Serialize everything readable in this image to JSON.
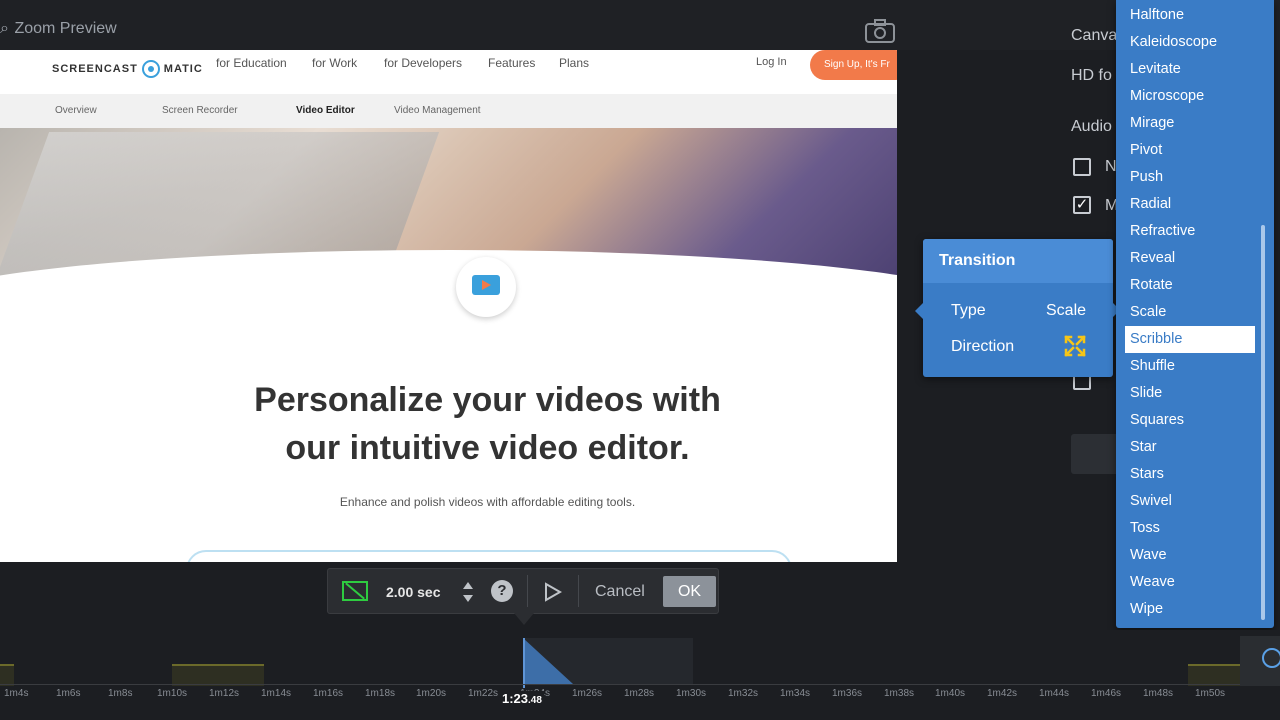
{
  "window": {
    "title": "Zoom Preview"
  },
  "site": {
    "logo_text_left": "SCREENCAST",
    "logo_text_right": "MATIC",
    "nav": [
      "for Education",
      "for Work",
      "for Developers",
      "Features",
      "Plans"
    ],
    "login": "Log In",
    "signup": "Sign Up, It's Fr",
    "subnav": [
      "Overview",
      "Screen Recorder",
      "Video Editor",
      "Video Management"
    ],
    "subnav_active": "Video Editor",
    "headline_1": "Personalize your videos with",
    "headline_2": "our intuitive video editor.",
    "subline": "Enhance and polish videos with affordable editing tools."
  },
  "right_panel": {
    "canvas_label": "Canva",
    "canvas_value": "HD fo",
    "audio_label": "Audio",
    "option_1": "N",
    "option_2": "M",
    "option_2_checked": true
  },
  "transition": {
    "title": "Transition",
    "type_label": "Type",
    "type_value": "Scale",
    "direction_label": "Direction",
    "direction_icon": "expand-arrows-icon"
  },
  "dropdown": {
    "items": [
      "Halftone",
      "Kaleidoscope",
      "Levitate",
      "Microscope",
      "Mirage",
      "Pivot",
      "Push",
      "Radial",
      "Refractive",
      "Reveal",
      "Rotate",
      "Scale",
      "Scribble",
      "Shuffle",
      "Slide",
      "Squares",
      "Star",
      "Stars",
      "Swivel",
      "Toss",
      "Wave",
      "Weave",
      "Wipe"
    ],
    "highlighted": "Scribble"
  },
  "toolbar": {
    "duration": "2.00 sec",
    "help": "?",
    "cancel": "Cancel",
    "ok": "OK"
  },
  "timeline": {
    "current_time": "1:23",
    "current_time_frac": ".48",
    "ticks": [
      "1m4s",
      "1m6s",
      "1m8s",
      "1m10s",
      "1m12s",
      "1m14s",
      "1m16s",
      "1m18s",
      "1m20s",
      "1m22s",
      "1m24s",
      "1m26s",
      "1m28s",
      "1m30s",
      "1m32s",
      "1m34s",
      "1m36s",
      "1m38s",
      "1m40s",
      "1m42s",
      "1m44s",
      "1m46s",
      "1m48s",
      "1m50s"
    ]
  },
  "colors": {
    "accent_blue": "#3a7cc6",
    "signup_orange": "#f27a4a",
    "crop_green": "#2ecc40",
    "direction_yellow": "#f5c518"
  }
}
